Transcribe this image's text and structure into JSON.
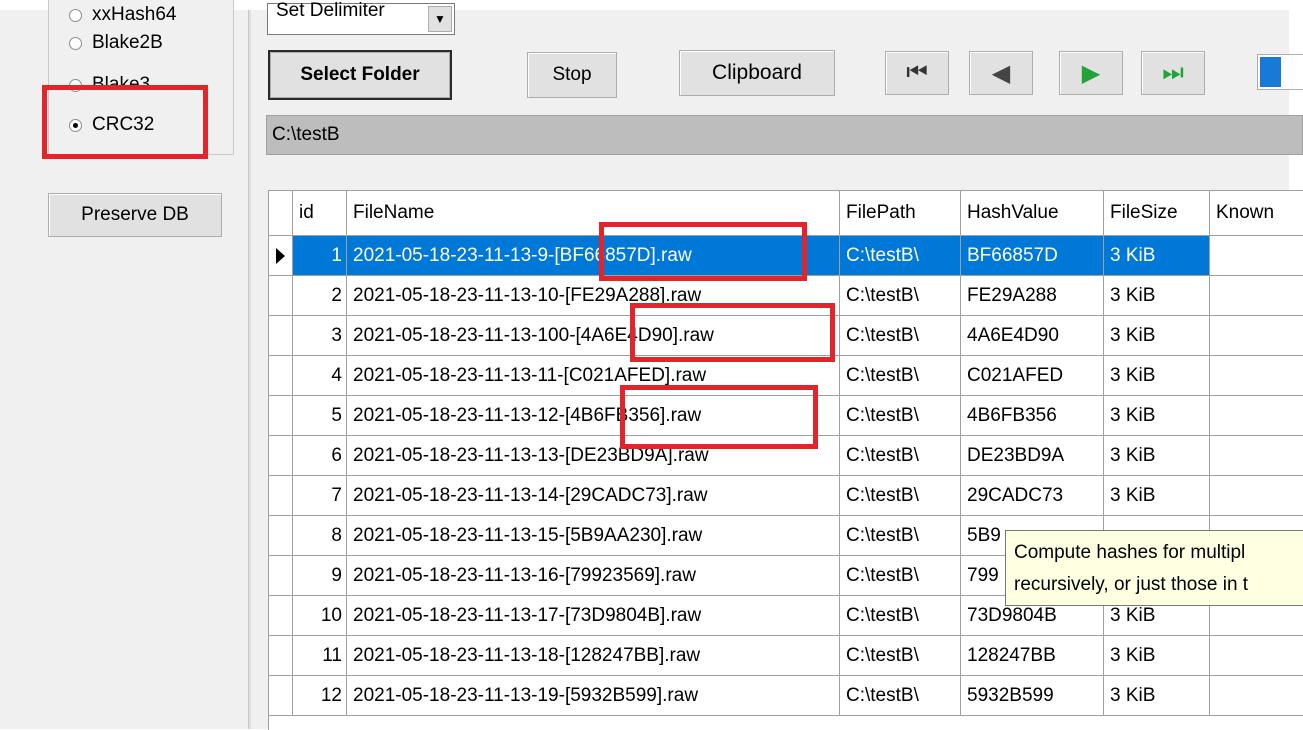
{
  "hash_algorithms": [
    {
      "label": "xxHash64",
      "selected": false
    },
    {
      "label": "Blake2B",
      "selected": false
    },
    {
      "label": "Blake3",
      "selected": false
    },
    {
      "label": "CRC32",
      "selected": true
    }
  ],
  "preserve_db_label": "Preserve DB",
  "delimiter": {
    "selected": "Set Delimiter"
  },
  "toolbar": {
    "select_folder": "Select Folder",
    "stop": "Stop",
    "clipboard": "Clipboard",
    "progress_fraction": 0.5
  },
  "nav": {
    "first": "⏮",
    "prev": "◀",
    "next": "▶",
    "last": "⏭"
  },
  "path": "C:\\testB",
  "grid": {
    "columns": [
      "id",
      "FileName",
      "FilePath",
      "HashValue",
      "FileSize",
      "Known"
    ],
    "rows": [
      {
        "id": "1",
        "name": "2021-05-18-23-11-13-9-[BF66857D].raw",
        "path": "C:\\testB\\",
        "hash": "BF66857D",
        "size": "3 KiB"
      },
      {
        "id": "2",
        "name": "2021-05-18-23-11-13-10-[FE29A288].raw",
        "path": "C:\\testB\\",
        "hash": "FE29A288",
        "size": "3 KiB"
      },
      {
        "id": "3",
        "name": "2021-05-18-23-11-13-100-[4A6E4D90].raw",
        "path": "C:\\testB\\",
        "hash": "4A6E4D90",
        "size": "3 KiB"
      },
      {
        "id": "4",
        "name": "2021-05-18-23-11-13-11-[C021AFED].raw",
        "path": "C:\\testB\\",
        "hash": "C021AFED",
        "size": "3 KiB"
      },
      {
        "id": "5",
        "name": "2021-05-18-23-11-13-12-[4B6FB356].raw",
        "path": "C:\\testB\\",
        "hash": "4B6FB356",
        "size": "3 KiB"
      },
      {
        "id": "6",
        "name": "2021-05-18-23-11-13-13-[DE23BD9A].raw",
        "path": "C:\\testB\\",
        "hash": "DE23BD9A",
        "size": "3 KiB"
      },
      {
        "id": "7",
        "name": "2021-05-18-23-11-13-14-[29CADC73].raw",
        "path": "C:\\testB\\",
        "hash": "29CADC73",
        "size": "3 KiB"
      },
      {
        "id": "8",
        "name": "2021-05-18-23-11-13-15-[5B9AA230].raw",
        "path": "C:\\testB\\",
        "hash": "5B9",
        "size": ""
      },
      {
        "id": "9",
        "name": "2021-05-18-23-11-13-16-[79923569].raw",
        "path": "C:\\testB\\",
        "hash": "799",
        "size": ""
      },
      {
        "id": "10",
        "name": "2021-05-18-23-11-13-17-[73D9804B].raw",
        "path": "C:\\testB\\",
        "hash": "73D9804B",
        "size": "3 KiB"
      },
      {
        "id": "11",
        "name": "2021-05-18-23-11-13-18-[128247BB].raw",
        "path": "C:\\testB\\",
        "hash": "128247BB",
        "size": "3 KiB"
      },
      {
        "id": "12",
        "name": "2021-05-18-23-11-13-19-[5932B599].raw",
        "path": "C:\\testB\\",
        "hash": "5932B599",
        "size": "3 KiB"
      }
    ]
  },
  "tooltip": {
    "line1": "Compute hashes for multipl",
    "line2": "recursively, or just those in t"
  },
  "colors": {
    "selection": "#0078d7",
    "highlight": "#e2242b",
    "tooltip_bg": "#ffffe1"
  }
}
